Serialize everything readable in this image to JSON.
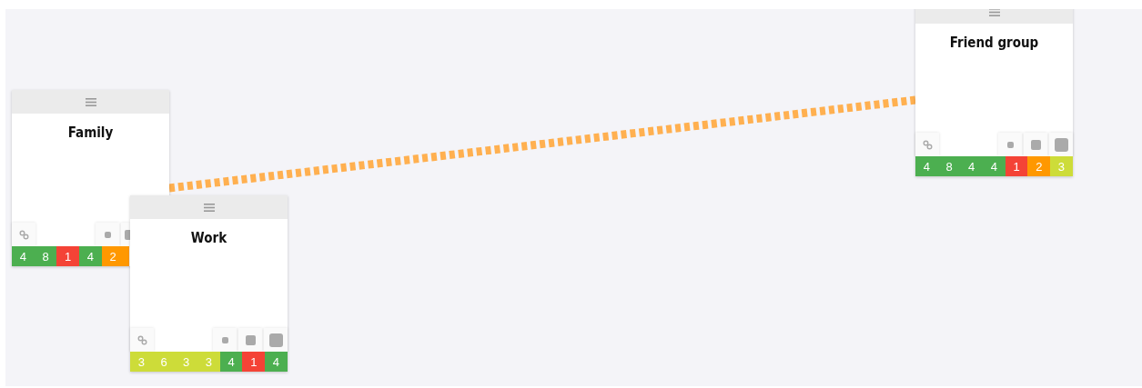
{
  "cards": [
    {
      "title": "Family",
      "scores": [
        {
          "value": "4",
          "color": "#4caf50"
        },
        {
          "value": "8",
          "color": "#4caf50"
        },
        {
          "value": "1",
          "color": "#f44336"
        },
        {
          "value": "4",
          "color": "#4caf50"
        },
        {
          "value": "2",
          "color": "#ff9800"
        },
        {
          "color": "#ff9800"
        }
      ]
    },
    {
      "title": "Work",
      "scores": [
        {
          "value": "3",
          "color": "#cddc39"
        },
        {
          "value": "6",
          "color": "#cddc39"
        },
        {
          "value": "3",
          "color": "#cddc39"
        },
        {
          "value": "3",
          "color": "#cddc39"
        },
        {
          "value": "4",
          "color": "#4caf50"
        },
        {
          "value": "1",
          "color": "#f44336"
        },
        {
          "value": "4",
          "color": "#4caf50"
        }
      ]
    },
    {
      "title": "Friend group",
      "scores": [
        {
          "value": "4",
          "color": "#4caf50"
        },
        {
          "value": "8",
          "color": "#4caf50"
        },
        {
          "value": "4",
          "color": "#4caf50"
        },
        {
          "value": "4",
          "color": "#4caf50"
        },
        {
          "value": "1",
          "color": "#f44336"
        },
        {
          "value": "2",
          "color": "#ff9800"
        },
        {
          "value": "3",
          "color": "#cddc39"
        }
      ]
    }
  ]
}
